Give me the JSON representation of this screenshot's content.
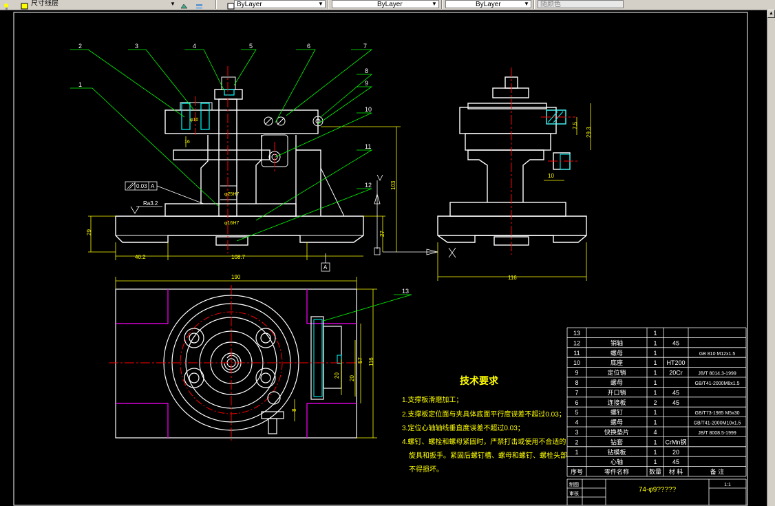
{
  "toolbar": {
    "layer_value": "尺寸线层",
    "color_value": "ByLayer",
    "linetype_value": "ByLayer",
    "lineweight_value": "ByLayer",
    "plotstyle_value": "随颜色"
  },
  "balloons": [
    "1",
    "2",
    "3",
    "4",
    "5",
    "6",
    "7",
    "8",
    "9",
    "10",
    "11",
    "12",
    "13"
  ],
  "dims": {
    "front_height": "103",
    "front_base_h": "29",
    "front_left": "40.2",
    "front_base_w": "108.7",
    "front_d": "27",
    "front_tol": "0.03",
    "datum": "A",
    "roughness": "Ra3.2",
    "bore1": "φ25H7",
    "bore2": "φ16H7",
    "bore3": "φ10",
    "side_w": "116",
    "side_75": "7.5",
    "side_293": "29.3",
    "side_10": "10",
    "plan_190": "190",
    "plan_116": "116",
    "plan_57": "57",
    "plan_20a": "20",
    "plan_20b": "20",
    "plan_8": "8",
    "plan_15": "16"
  },
  "notes": {
    "title": "技术要求",
    "items": [
      "1.支撑板滑磨加工；",
      "2.支撑板定位面与夹具体底面平行度误差不超过0.03；",
      "3.定位心轴轴线垂直度误差不超过0.03；",
      "4.螺钉、螺栓和螺母紧固时，严禁打击或使用不合适的",
      "旋具和扳手。紧固后螺钉槽、螺母和螺钉、螺栓头部",
      "不得损坏。"
    ]
  },
  "bom": {
    "rows": [
      {
        "no": "13",
        "name": "",
        "qty": "1",
        "mat": "",
        "note": ""
      },
      {
        "no": "12",
        "name": "销轴",
        "qty": "1",
        "mat": "45",
        "note": ""
      },
      {
        "no": "11",
        "name": "螺母",
        "qty": "1",
        "mat": "",
        "note": "GB 810 M12x1.5"
      },
      {
        "no": "10",
        "name": "底座",
        "qty": "1",
        "mat": "HT200",
        "note": ""
      },
      {
        "no": "9",
        "name": "定位销",
        "qty": "1",
        "mat": "20Cr",
        "note": "JB/T 8014.3-1999"
      },
      {
        "no": "8",
        "name": "螺母",
        "qty": "1",
        "mat": "",
        "note": "GB/T41-2000M8x1.5"
      },
      {
        "no": "7",
        "name": "开口销",
        "qty": "1",
        "mat": "45",
        "note": ""
      },
      {
        "no": "6",
        "name": "连接板",
        "qty": "2",
        "mat": "45",
        "note": ""
      },
      {
        "no": "5",
        "name": "螺钉",
        "qty": "1",
        "mat": "",
        "note": "GB/T73-1985 M5x30"
      },
      {
        "no": "4",
        "name": "螺母",
        "qty": "1",
        "mat": "",
        "note": "GB/T41-2000M10x1.5"
      },
      {
        "no": "3",
        "name": "快换垫片",
        "qty": "4",
        "mat": "",
        "note": "JB/T 8008.5-1999"
      },
      {
        "no": "2",
        "name": "钻套",
        "qty": "1",
        "mat": "CrMn钢",
        "note": ""
      },
      {
        "no": "1",
        "name": "钻模板",
        "qty": "1",
        "mat": "20",
        "note": ""
      },
      {
        "no": "",
        "name": "心轴",
        "qty": "1",
        "mat": "45",
        "note": ""
      }
    ],
    "header": {
      "no": "序号",
      "name": "零件名称",
      "qty": "数量",
      "mat": "材 料",
      "note": "备 注"
    },
    "title_block": {
      "draw": "制图",
      "check": "审核",
      "drawing_no": "74-φ9?????",
      "scale": "1:1"
    }
  }
}
